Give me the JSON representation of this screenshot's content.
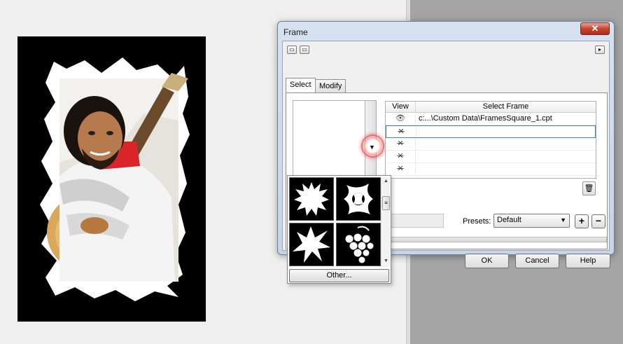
{
  "dialog": {
    "title": "Frame",
    "close_label": "✕",
    "tabs": [
      {
        "label": "Select",
        "active": true
      },
      {
        "label": "Modify",
        "active": false
      }
    ],
    "table": {
      "headers": [
        "View",
        "Select Frame"
      ],
      "rows": [
        {
          "view": "👁",
          "frame": "c:...\\Custom Data\\FramesSquare_1.cpt",
          "visible": true
        },
        {
          "view": "✕",
          "frame": "",
          "visible": false,
          "selected": true
        },
        {
          "view": "✕",
          "frame": "",
          "visible": false
        },
        {
          "view": "✕",
          "frame": "",
          "visible": false
        },
        {
          "view": "✕",
          "frame": "",
          "visible": false
        }
      ]
    },
    "presets_label": "Presets:",
    "presets_value": "Default",
    "plus_label": "+",
    "minus_label": "−",
    "ok_label": "OK",
    "cancel_label": "Cancel",
    "help_label": "Help"
  },
  "popup": {
    "other_label": "Other...",
    "thumbnails": [
      "frame-burst",
      "frame-floral",
      "frame-splatter",
      "frame-grapes"
    ]
  },
  "icons": {
    "trash": "trash-icon",
    "dropdown": "chevron-down-icon",
    "flyout": "flyout-arrow-icon"
  },
  "colors": {
    "accent_selection": "#3c7fd3",
    "close_button": "#c7452e",
    "highlight_ring": "#e65050"
  }
}
